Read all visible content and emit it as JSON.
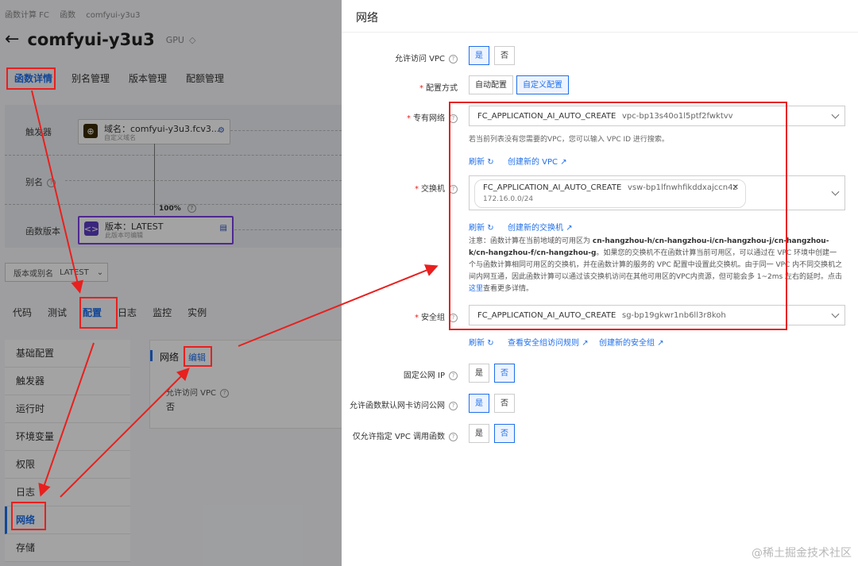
{
  "breadcrumb": [
    "函数计算 FC",
    "函数",
    "comfyui-y3u3"
  ],
  "function": {
    "name": "comfyui-y3u3",
    "tag": "GPU"
  },
  "top_tabs": [
    "函数详情",
    "别名管理",
    "版本管理",
    "配额管理"
  ],
  "topology": {
    "labels": {
      "trigger": "触发器",
      "alias": "别名",
      "version": "函数版本"
    },
    "domain_node": {
      "title": "域名：comfyui-y3u3.fcv3...",
      "sub": "自定义域名"
    },
    "percent": "100%",
    "version_node": {
      "title": "版本：LATEST",
      "sub": "此版本可编辑"
    }
  },
  "version_select": {
    "label": "版本或别名",
    "value": "LATEST"
  },
  "sub_tabs": [
    "代码",
    "测试",
    "配置",
    "日志",
    "监控",
    "实例"
  ],
  "side_menu": [
    "基础配置",
    "触发器",
    "运行时",
    "环境变量",
    "权限",
    "日志",
    "网络",
    "存储"
  ],
  "network_card": {
    "title": "网络",
    "edit": "编辑",
    "field_label": "允许访问 VPC",
    "field_value": "否"
  },
  "panel": {
    "title": "网络",
    "allow_vpc": {
      "label": "允许访问 VPC",
      "yes": "是",
      "no": "否",
      "selected": "是"
    },
    "config_mode": {
      "label": "配置方式",
      "auto": "自动配置",
      "custom": "自定义配置",
      "selected": "自定义配置"
    },
    "vpc": {
      "label": "专有网络",
      "name": "FC_APPLICATION_AI_AUTO_CREATE",
      "id": "vpc-bp13s40o1l5ptf2fwktvv",
      "hint": "若当前列表没有您需要的VPC，您可以输入 VPC ID 进行搜索。",
      "refresh": "刷新",
      "create": "创建新的 VPC"
    },
    "vswitch": {
      "label": "交换机",
      "name": "FC_APPLICATION_AI_AUTO_CREATE",
      "id": "vsw-bp1lfnwhfikddxajccn4z",
      "cidr": "172.16.0.0/24",
      "refresh": "刷新",
      "create": "创建新的交换机"
    },
    "note": {
      "prefix": "注意：函数计算在当前地域的可用区为 ",
      "zones": "cn-hangzhou-h/cn-hangzhou-i/cn-hangzhou-j/cn-hangzhou-k/cn-hangzhou-f/cn-hangzhou-g",
      "body": "。如果您的交换机不在函数计算当前可用区，可以通过在 VPC 环境中创建一个与函数计算相同可用区的交换机，并在函数计算的服务的 VPC 配置中设置此交换机。由于同一 VPC 内不同交换机之间内网互通，因此函数计算可以通过该交换机访问在其他可用区的VPC内资源，但可能会多 1~2ms 左右的延时。点击",
      "link": "这里",
      "suffix": "查看更多详情。"
    },
    "security_group": {
      "label": "安全组",
      "name": "FC_APPLICATION_AI_AUTO_CREATE",
      "id": "sg-bp19gkwr1nb6ll3r8koh",
      "refresh": "刷新",
      "view_rules": "查看安全组访问规则",
      "create": "创建新的安全组"
    },
    "fixed_ip": {
      "label": "固定公网 IP",
      "yes": "是",
      "no": "否",
      "selected": "否"
    },
    "default_nic": {
      "label": "允许函数默认网卡访问公网",
      "yes": "是",
      "no": "否",
      "selected": "是"
    },
    "vpc_only": {
      "label": "仅允许指定 VPC 调用函数",
      "yes": "是",
      "no": "否",
      "selected": "否"
    }
  },
  "watermark": "@稀土掘金技术社区",
  "colors": {
    "accent": "#1f6feb",
    "annotation": "#e8201e"
  }
}
